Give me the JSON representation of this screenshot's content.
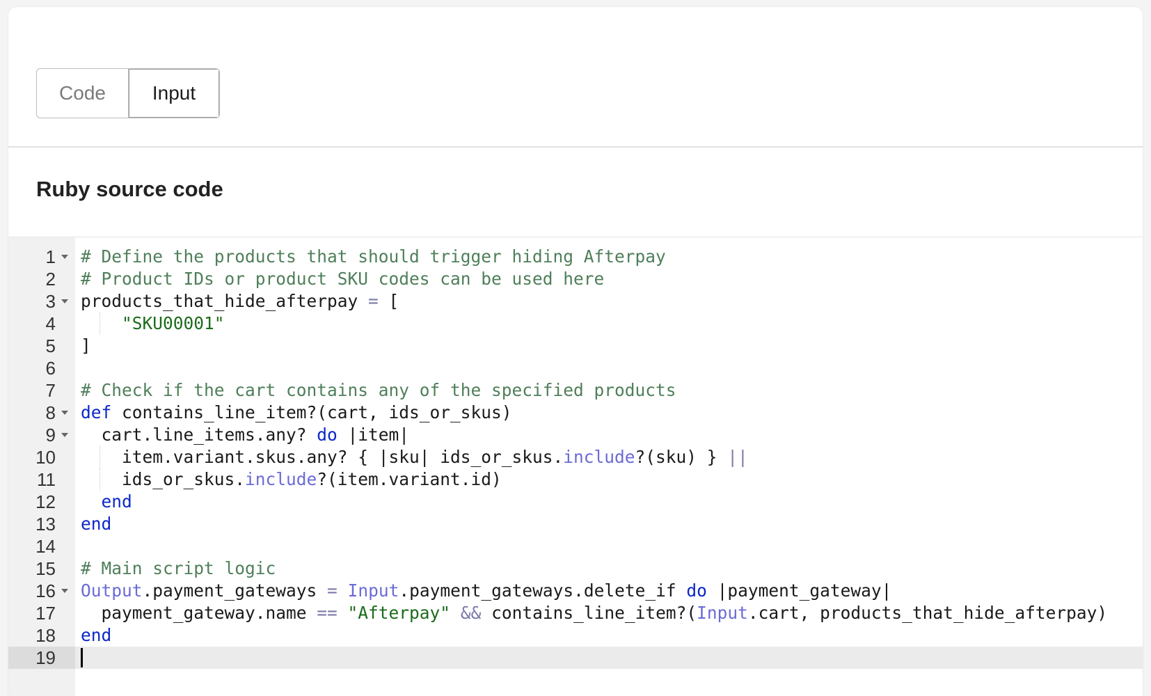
{
  "tabs": [
    {
      "label": "Code",
      "selected": false
    },
    {
      "label": "Input",
      "selected": true
    }
  ],
  "section_title": "Ruby source code",
  "editor": {
    "language": "ruby",
    "active_line": 19,
    "colors": {
      "comment": "#4f7f5a",
      "keyword": "#0b27c9",
      "string": "#1b6b1b",
      "constant": "#6b6bd6",
      "operator": "#7a7aa8"
    },
    "lines": [
      {
        "n": "1",
        "fold": true,
        "tokens": [
          {
            "t": "# Define the products that should trigger hiding Afterpay",
            "c": "cm"
          }
        ]
      },
      {
        "n": "2",
        "fold": false,
        "tokens": [
          {
            "t": "# Product IDs or product SKU codes can be used here",
            "c": "cm"
          }
        ]
      },
      {
        "n": "3",
        "fold": true,
        "tokens": [
          {
            "t": "products_that_hide_afterpay ",
            "c": ""
          },
          {
            "t": "=",
            "c": "op"
          },
          {
            "t": " [",
            "c": ""
          }
        ]
      },
      {
        "n": "4",
        "fold": false,
        "guides": [
          1
        ],
        "tokens": [
          {
            "t": "    ",
            "c": ""
          },
          {
            "t": "\"SKU00001\"",
            "c": "st"
          }
        ]
      },
      {
        "n": "5",
        "fold": false,
        "tokens": [
          {
            "t": "]",
            "c": ""
          }
        ]
      },
      {
        "n": "6",
        "fold": false,
        "tokens": []
      },
      {
        "n": "7",
        "fold": false,
        "tokens": [
          {
            "t": "# Check if the cart contains any of the specified products",
            "c": "cm"
          }
        ]
      },
      {
        "n": "8",
        "fold": true,
        "tokens": [
          {
            "t": "def",
            "c": "kw"
          },
          {
            "t": " contains_line_item?(cart, ids_or_skus)",
            "c": ""
          }
        ]
      },
      {
        "n": "9",
        "fold": true,
        "tokens": [
          {
            "t": "  cart.line_items.any? ",
            "c": ""
          },
          {
            "t": "do",
            "c": "kw"
          },
          {
            "t": " |item|",
            "c": ""
          }
        ]
      },
      {
        "n": "10",
        "fold": false,
        "guides": [
          1
        ],
        "tokens": [
          {
            "t": "    item.variant.skus.any? { |sku| ids_or_skus.",
            "c": ""
          },
          {
            "t": "include",
            "c": "cn"
          },
          {
            "t": "?(sku) } ",
            "c": ""
          },
          {
            "t": "||",
            "c": "op"
          }
        ]
      },
      {
        "n": "11",
        "fold": false,
        "guides": [
          1
        ],
        "tokens": [
          {
            "t": "    ids_or_skus.",
            "c": ""
          },
          {
            "t": "include",
            "c": "cn"
          },
          {
            "t": "?(item.variant.id)",
            "c": ""
          }
        ]
      },
      {
        "n": "12",
        "fold": false,
        "tokens": [
          {
            "t": "  ",
            "c": ""
          },
          {
            "t": "end",
            "c": "kw"
          }
        ]
      },
      {
        "n": "13",
        "fold": false,
        "tokens": [
          {
            "t": "end",
            "c": "kw"
          }
        ]
      },
      {
        "n": "14",
        "fold": false,
        "tokens": []
      },
      {
        "n": "15",
        "fold": false,
        "tokens": [
          {
            "t": "# Main script logic",
            "c": "cm"
          }
        ]
      },
      {
        "n": "16",
        "fold": true,
        "tokens": [
          {
            "t": "Output",
            "c": "cn"
          },
          {
            "t": ".payment_gateways ",
            "c": ""
          },
          {
            "t": "=",
            "c": "op"
          },
          {
            "t": " ",
            "c": ""
          },
          {
            "t": "Input",
            "c": "cn"
          },
          {
            "t": ".payment_gateways.delete_if ",
            "c": ""
          },
          {
            "t": "do",
            "c": "kw"
          },
          {
            "t": " |payment_gateway|",
            "c": ""
          }
        ]
      },
      {
        "n": "17",
        "fold": false,
        "tokens": [
          {
            "t": "  payment_gateway.name ",
            "c": ""
          },
          {
            "t": "==",
            "c": "op"
          },
          {
            "t": " ",
            "c": ""
          },
          {
            "t": "\"Afterpay\"",
            "c": "st"
          },
          {
            "t": " ",
            "c": ""
          },
          {
            "t": "&&",
            "c": "op"
          },
          {
            "t": " contains_line_item?(",
            "c": ""
          },
          {
            "t": "Input",
            "c": "cn"
          },
          {
            "t": ".cart, products_that_hide_afterpay)",
            "c": ""
          }
        ]
      },
      {
        "n": "18",
        "fold": false,
        "tokens": [
          {
            "t": "end",
            "c": "kw"
          }
        ]
      },
      {
        "n": "19",
        "fold": false,
        "tokens": []
      }
    ]
  }
}
